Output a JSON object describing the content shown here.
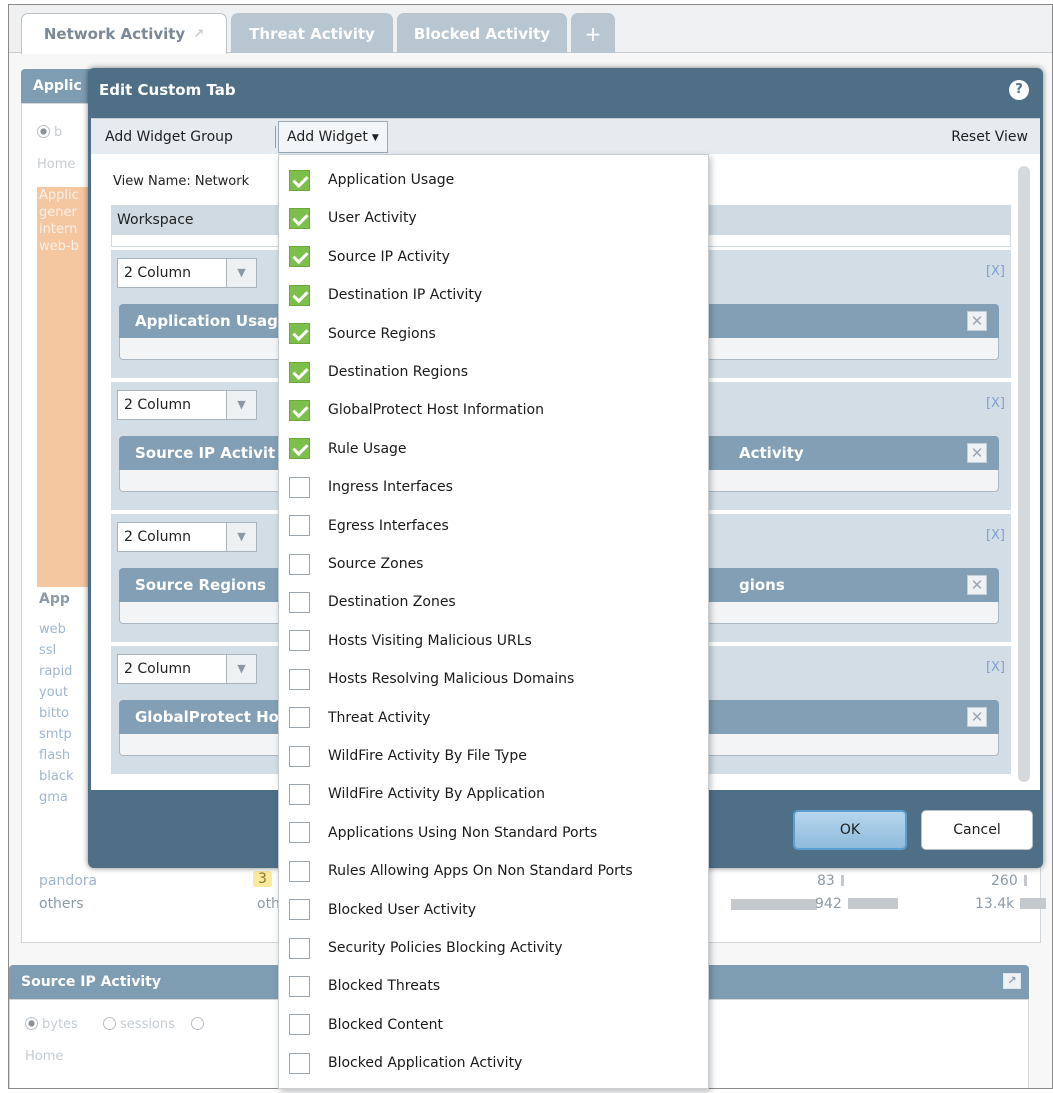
{
  "tabs": {
    "network": "Network Activity",
    "threat": "Threat Activity",
    "blocked": "Blocked Activity",
    "add": "+"
  },
  "background": {
    "panel1_title": "Applic",
    "radio_label": "b",
    "home": "Home",
    "orange_lines": [
      "Applic",
      "gener",
      "intern",
      "web-b"
    ],
    "apps_header": "App",
    "app_list": [
      "web",
      "ssl",
      "rapid",
      "yout",
      "bitto",
      "smtp",
      "flash",
      "black",
      "gma"
    ],
    "row_pandora": {
      "name": "pandora",
      "count": "3",
      "v1": "83",
      "v2": "260"
    },
    "row_others": {
      "name": "others",
      "cat": "othe",
      "v1": "942",
      "v2": "13.4k"
    },
    "panel2_title": "Source IP Activity",
    "panel2_radios": [
      "bytes",
      "sessions"
    ],
    "panel2_home": "Home"
  },
  "dialog": {
    "title": "Edit Custom Tab",
    "help": "?",
    "toolbar": {
      "add_widget_group": "Add Widget Group",
      "add_widget": "Add Widget",
      "reset_view": "Reset View"
    },
    "view_name": "View Name: Network",
    "workspace": "Workspace",
    "groups": [
      {
        "columns": "2 Column",
        "remove": "[X]",
        "widget_left": "Application Usag",
        "widget_right": ""
      },
      {
        "columns": "2 Column",
        "remove": "[X]",
        "widget_left": "Source IP Activit",
        "widget_right": "Activity"
      },
      {
        "columns": "2 Column",
        "remove": "[X]",
        "widget_left": "Source Regions",
        "widget_right": "gions"
      },
      {
        "columns": "2 Column",
        "remove": "[X]",
        "widget_left": "GlobalProtect Ho",
        "widget_right": ""
      }
    ],
    "ok": "OK",
    "cancel": "Cancel"
  },
  "menu": {
    "items": [
      {
        "label": "Application Usage",
        "checked": true
      },
      {
        "label": "User Activity",
        "checked": true
      },
      {
        "label": "Source IP Activity",
        "checked": true
      },
      {
        "label": "Destination IP Activity",
        "checked": true
      },
      {
        "label": "Source Regions",
        "checked": true
      },
      {
        "label": "Destination Regions",
        "checked": true
      },
      {
        "label": "GlobalProtect Host Information",
        "checked": true
      },
      {
        "label": "Rule Usage",
        "checked": true
      },
      {
        "label": "Ingress Interfaces",
        "checked": false
      },
      {
        "label": "Egress Interfaces",
        "checked": false
      },
      {
        "label": "Source Zones",
        "checked": false
      },
      {
        "label": "Destination Zones",
        "checked": false
      },
      {
        "label": "Hosts Visiting Malicious URLs",
        "checked": false
      },
      {
        "label": "Hosts Resolving Malicious Domains",
        "checked": false
      },
      {
        "label": "Threat Activity",
        "checked": false
      },
      {
        "label": "WildFire Activity By File Type",
        "checked": false
      },
      {
        "label": "WildFire Activity By Application",
        "checked": false
      },
      {
        "label": "Applications Using Non Standard Ports",
        "checked": false
      },
      {
        "label": "Rules Allowing Apps On Non Standard Ports",
        "checked": false
      },
      {
        "label": "Blocked User Activity",
        "checked": false
      },
      {
        "label": "Security Policies Blocking Activity",
        "checked": false
      },
      {
        "label": "Blocked Threats",
        "checked": false
      },
      {
        "label": "Blocked Content",
        "checked": false
      },
      {
        "label": "Blocked Application Activity",
        "checked": false
      }
    ]
  }
}
